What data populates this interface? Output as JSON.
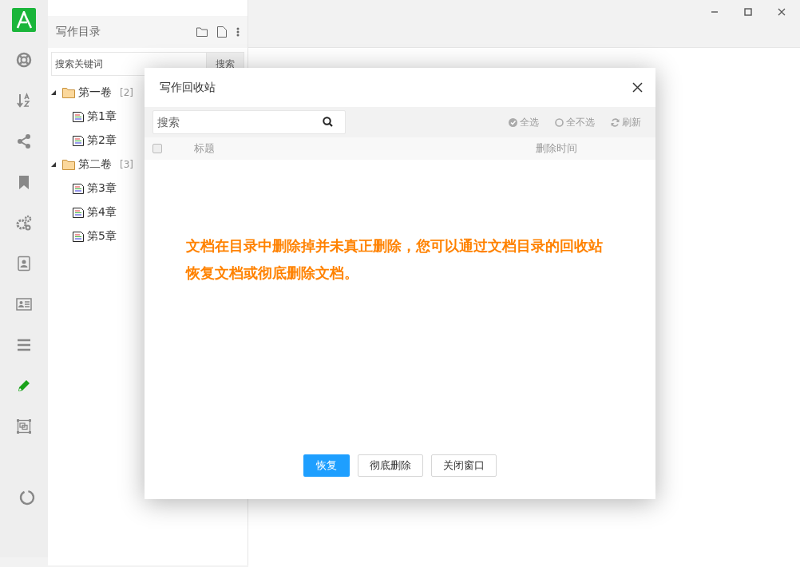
{
  "rail": {
    "items": [
      {
        "selected": false
      },
      {
        "selected": false
      },
      {
        "selected": false
      },
      {
        "selected": false
      },
      {
        "selected": false
      },
      {
        "selected": false
      },
      {
        "selected": false
      },
      {
        "selected": false
      },
      {
        "selected": true
      },
      {
        "selected": false
      }
    ]
  },
  "panel": {
    "title": "写作目录",
    "search": {
      "placeholder": "搜索关键词",
      "button": "搜索"
    },
    "tree": [
      {
        "name": "第一卷",
        "count": "[2]",
        "expanded": true,
        "children": [
          {
            "name": "第1章"
          },
          {
            "name": "第2章"
          }
        ]
      },
      {
        "name": "第二卷",
        "count": "[3]",
        "expanded": true,
        "children": [
          {
            "name": "第3章"
          },
          {
            "name": "第4章"
          },
          {
            "name": "第5章"
          }
        ]
      }
    ]
  },
  "dialog": {
    "title": "写作回收站",
    "search": {
      "placeholder": "搜索"
    },
    "actions": [
      {
        "kind": "check",
        "label": "全选"
      },
      {
        "kind": "uncheck",
        "label": "全不选"
      },
      {
        "kind": "refresh",
        "label": "刷新"
      }
    ],
    "table": {
      "select_all": {
        "checked": false
      },
      "columns": [
        "标题",
        "删除时间"
      ]
    },
    "message": "文档在目录中删除掉并未真正删除，您可以通过文档目录的回收站恢复文档或彻底删除文档。",
    "buttons": [
      {
        "label": "恢复",
        "kind": "primary"
      },
      {
        "label": "彻底删除",
        "kind": "default"
      },
      {
        "label": "关闭窗口",
        "kind": "default"
      }
    ]
  }
}
